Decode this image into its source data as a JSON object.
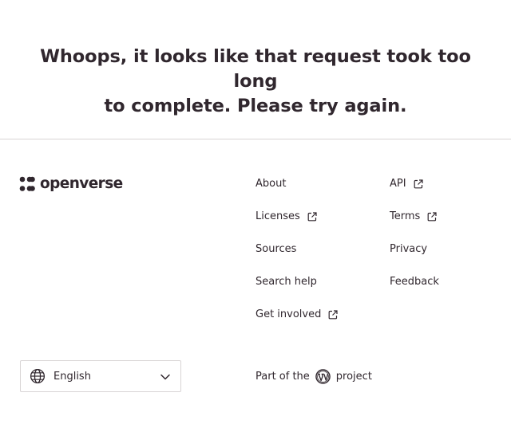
{
  "error": {
    "line1": "Whoops, it looks like that request took too long",
    "line2": "to complete. Please try again."
  },
  "footer": {
    "logo_text": "openverse",
    "links_col1": [
      {
        "label": "About",
        "external": false
      },
      {
        "label": "Licenses",
        "external": true
      },
      {
        "label": "Sources",
        "external": false
      },
      {
        "label": "Search help",
        "external": false
      },
      {
        "label": "Get involved",
        "external": true
      }
    ],
    "links_col2": [
      {
        "label": "API",
        "external": true
      },
      {
        "label": "Terms",
        "external": true
      },
      {
        "label": "Privacy",
        "external": false
      },
      {
        "label": "Feedback",
        "external": false
      }
    ],
    "language": {
      "label": "English",
      "icon": "globe-icon"
    },
    "part_of": {
      "prefix": "Part of the",
      "suffix": "project",
      "icon": "wordpress-icon"
    }
  },
  "colors": {
    "text": "#30272e",
    "border": "#d8d4d5",
    "background": "#ffffff"
  }
}
